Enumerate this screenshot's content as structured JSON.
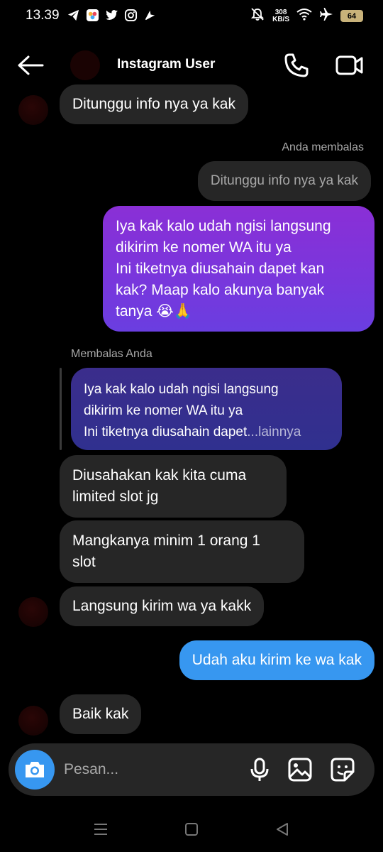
{
  "status_bar": {
    "time": "13.39",
    "net_speed_value": "308",
    "net_speed_unit": "KB/S",
    "battery": "64"
  },
  "header": {
    "title": "Instagram User"
  },
  "messages": [
    {
      "side": "in",
      "text": "Ditunggu info nya ya kak"
    },
    {
      "side": "meta",
      "text": "Anda membalas"
    },
    {
      "side": "reply-quote",
      "text": "Ditunggu info nya ya kak"
    },
    {
      "side": "out",
      "lines": [
        "Iya kak kalo udah ngisi langsung",
        "dikirim ke nomer WA itu ya",
        "Ini tiketnya diusahain dapet kan",
        "kak? Maap kalo akunya banyak",
        "tanya 😭🙏"
      ]
    },
    {
      "side": "meta",
      "text": "Membalas Anda"
    },
    {
      "side": "quoted",
      "lines": [
        "Iya kak kalo udah ngisi langsung",
        "dikirim ke nomer WA itu ya",
        "Ini tiketnya diusahain dapet"
      ],
      "more": "...lainnya"
    },
    {
      "side": "in",
      "lines": [
        "Diusahakan kak kita cuma",
        "limited slot jg"
      ]
    },
    {
      "side": "in",
      "lines": [
        "Mangkanya minim 1 orang 1",
        "slot"
      ]
    },
    {
      "side": "in",
      "text": "Langsung kirim wa ya kakk"
    },
    {
      "side": "out",
      "text": "Udah aku kirim ke wa kak"
    },
    {
      "side": "in",
      "text": "Baik kak"
    }
  ],
  "composer": {
    "placeholder": "Pesan..."
  },
  "colors": {
    "background": "#000000",
    "incoming_bubble": "#262626",
    "outgoing_blue": "#3797f0",
    "outgoing_purple": "#7a36dc",
    "meta_text": "#a8a8a8"
  }
}
